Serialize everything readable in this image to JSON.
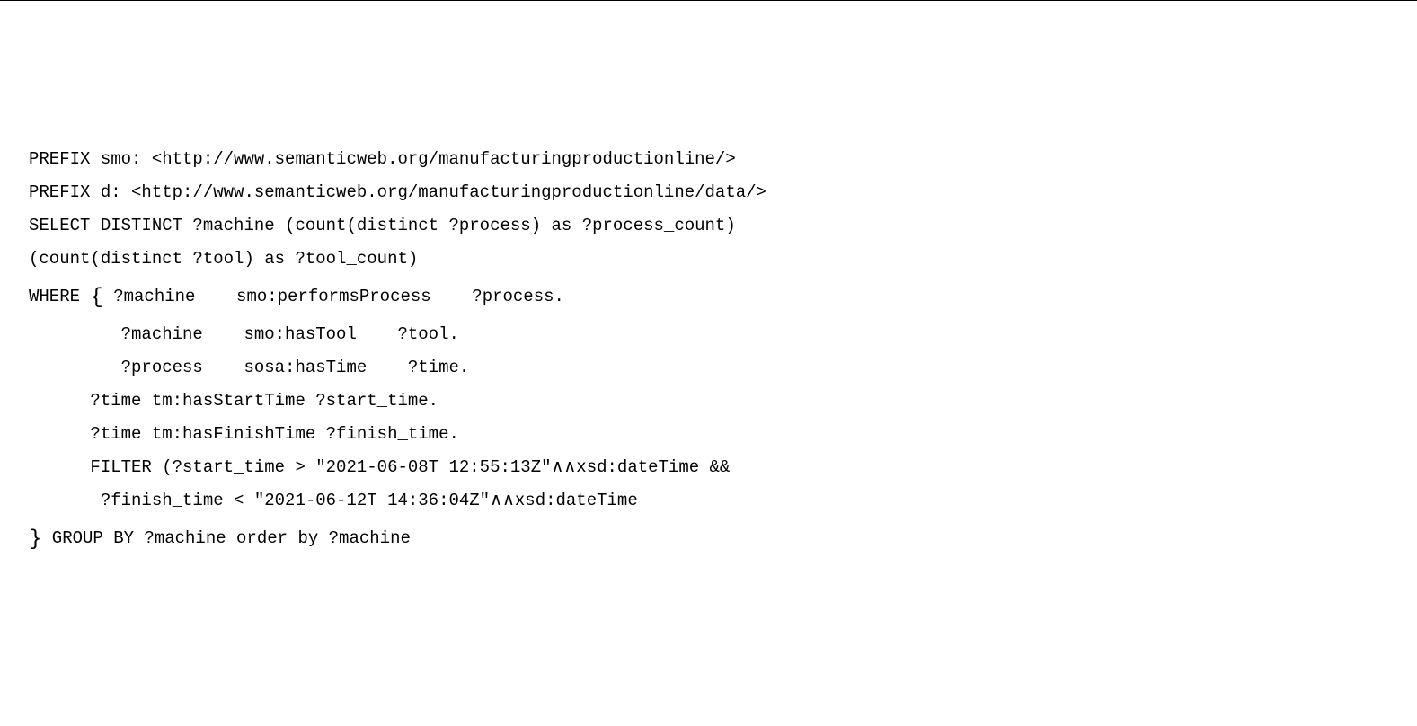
{
  "code": {
    "line1": "PREFIX smo: <http://www.semanticweb.org/manufacturingproductionline/>",
    "line2": "PREFIX d: <http://www.semanticweb.org/manufacturingproductionline/data/>",
    "line3": "SELECT DISTINCT ?machine (count(distinct ?process) as ?process_count)",
    "line4": "(count(distinct ?tool) as ?tool_count)",
    "line5_prefix": "WHERE ",
    "line5_brace": "{",
    "line5_rest": " ?machine    smo:performsProcess    ?process.",
    "line6": "         ?machine    smo:hasTool    ?tool.",
    "line7": "         ?process    sosa:hasTime    ?time.",
    "line8": "      ?time tm:hasStartTime ?start_time.",
    "line9": "      ?time tm:hasFinishTime ?finish_time.",
    "line10": "      FILTER (?start_time > \"2021-06-08T 12:55:13Z\"∧∧xsd:dateTime &&",
    "line11": "       ?finish_time < \"2021-06-12T 14:36:04Z\"∧∧xsd:dateTime",
    "line12_brace": "}",
    "line12_rest": " GROUP BY ?machine order by ?machine"
  }
}
